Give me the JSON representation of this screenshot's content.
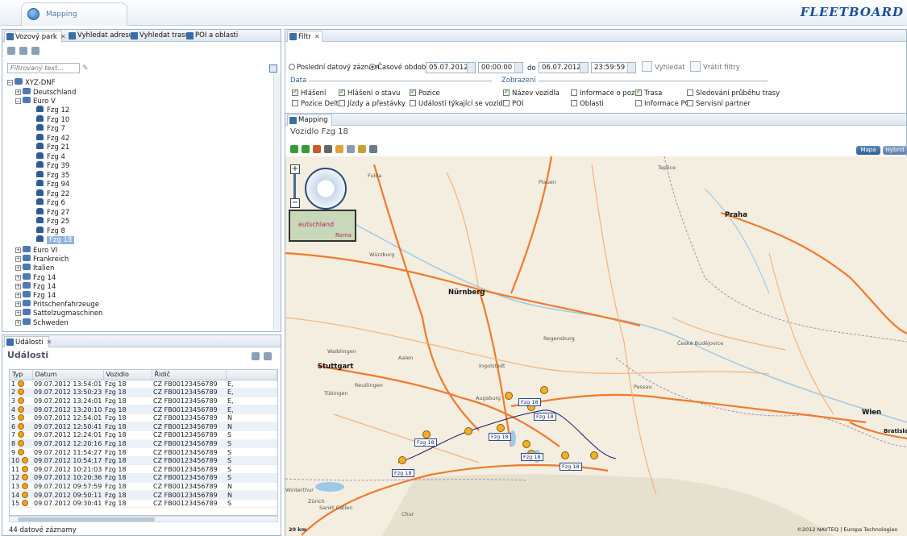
{
  "app": {
    "tab_label": "Mapping",
    "logo": "FLEETBOARD"
  },
  "left_top": {
    "tabs": [
      "Vozový park",
      "Vyhledat adresu",
      "Vyhledat trasu",
      "POI a oblasti"
    ],
    "filter_placeholder": "Filtrovaný text...",
    "tree": {
      "root": "XYZ-DNF",
      "groups": [
        "Deutschland",
        "Euro V"
      ],
      "vehicles": [
        "Fzg 12",
        "Fzg 10",
        "Fzg 7",
        "Fzg 42",
        "Fzg 21",
        "Fzg 4",
        "Fzg 39",
        "Fzg 35",
        "Fzg 94",
        "Fzg 22",
        "Fzg 6",
        "Fzg 27",
        "Fzg 25",
        "Fzg 8",
        "Fzg 18"
      ],
      "selected": "Fzg 18",
      "more_groups": [
        "Euro VI",
        "Frankreich",
        "Italien",
        "Fzg 14",
        "Fzg 14",
        "Fzg 14",
        "Pritschenfahrzeuge",
        "Sattelzugmaschinen",
        "Schweden"
      ]
    }
  },
  "events": {
    "tab": "Události",
    "heading": "Události",
    "columns": [
      "Typ",
      "Datum",
      "Vozidlo",
      "Řidič"
    ],
    "rows": [
      {
        "n": "1",
        "date": "09.07.2012 13:54:01",
        "vehicle": "Fzg 18",
        "driver": "CZ FB00123456789",
        "x": "E,"
      },
      {
        "n": "2",
        "date": "09.07.2012 13:50:23",
        "vehicle": "Fzg 18",
        "driver": "CZ FB00123456789",
        "x": "E,"
      },
      {
        "n": "3",
        "date": "09.07.2012 13:24:01",
        "vehicle": "Fzg 18",
        "driver": "CZ FB00123456789",
        "x": "E,"
      },
      {
        "n": "4",
        "date": "09.07.2012 13:20:10",
        "vehicle": "Fzg 18",
        "driver": "CZ FB00123456789",
        "x": "E,"
      },
      {
        "n": "5",
        "date": "09.07.2012 12:54:01",
        "vehicle": "Fzg 18",
        "driver": "CZ FB00123456789",
        "x": "N"
      },
      {
        "n": "6",
        "date": "09.07.2012 12:50:41",
        "vehicle": "Fzg 18",
        "driver": "CZ FB00123456789",
        "x": "N"
      },
      {
        "n": "7",
        "date": "09.07.2012 12:24:01",
        "vehicle": "Fzg 18",
        "driver": "CZ FB00123456789",
        "x": "S"
      },
      {
        "n": "8",
        "date": "09.07.2012 12:20:16",
        "vehicle": "Fzg 18",
        "driver": "CZ FB00123456789",
        "x": "S"
      },
      {
        "n": "9",
        "date": "09.07.2012 11:54:27",
        "vehicle": "Fzg 18",
        "driver": "CZ FB00123456789",
        "x": "S"
      },
      {
        "n": "10",
        "date": "09.07.2012 10:54:17",
        "vehicle": "Fzg 18",
        "driver": "CZ FB00123456789",
        "x": "S"
      },
      {
        "n": "11",
        "date": "09.07.2012 10:21:03",
        "vehicle": "Fzg 18",
        "driver": "CZ FB00123456789",
        "x": "S"
      },
      {
        "n": "12",
        "date": "09.07.2012 10:20:36",
        "vehicle": "Fzg 18",
        "driver": "CZ FB00123456789",
        "x": "S"
      },
      {
        "n": "13",
        "date": "09.07.2012 09:57:59",
        "vehicle": "Fzg 18",
        "driver": "CZ FB00123456789",
        "x": "N"
      },
      {
        "n": "14",
        "date": "09.07.2012 09:50:11",
        "vehicle": "Fzg 18",
        "driver": "CZ FB00123456789",
        "x": "N"
      },
      {
        "n": "15",
        "date": "09.07.2012 09:30:41",
        "vehicle": "Fzg 18",
        "driver": "CZ FB00123456789",
        "x": "S"
      }
    ],
    "count": "44 datové záznamy"
  },
  "filter": {
    "tab": "Filtr",
    "radio_last": "Poslední datový záznam",
    "radio_period": "Časové období",
    "date_from": "05.07.2012",
    "time_from": "00:00:00",
    "to_label": "do",
    "date_to": "06.07.2012",
    "time_to": "23:59:59",
    "search": "Vyhledat",
    "reset": "Vrátit filtry",
    "data_group": "Data",
    "data_items": [
      {
        "label": "Hlášení",
        "checked": true
      },
      {
        "label": "Hlášení o stavu",
        "checked": true
      },
      {
        "label": "Pozice",
        "checked": true
      },
      {
        "label": "Pozice Delta",
        "checked": false
      },
      {
        "label": "Jízdy a přestávky",
        "checked": false
      },
      {
        "label": "Události týkající se vozidla",
        "checked": false
      }
    ],
    "display_group": "Zobrazení",
    "display_items": [
      {
        "label": "Název vozidla",
        "checked": true
      },
      {
        "label": "Informace o pozici",
        "checked": false
      },
      {
        "label": "Trasa",
        "checked": true
      },
      {
        "label": "Sledování průběhu trasy",
        "checked": false
      },
      {
        "label": "POI",
        "checked": false
      },
      {
        "label": "Oblasti",
        "checked": false
      },
      {
        "label": "Informace POI",
        "checked": false
      },
      {
        "label": "Servisní partner",
        "checked": false
      }
    ]
  },
  "mapping": {
    "tab": "Mapping",
    "title": "Vozidlo Fzg 18",
    "btn_map": "Mapa",
    "btn_hybrid": "Hybrid",
    "cities": [
      "Praha",
      "Nürnberg",
      "Stuttgart",
      "Wien",
      "Bratislava"
    ],
    "towns": [
      "Würzburg",
      "Fulda",
      "Plauen",
      "Teplice",
      "Ingolstadt",
      "Regensburg",
      "Augsburg",
      "Reutlingen",
      "Tübingen",
      "Waiblingen",
      "Aalen",
      "České Budějovice",
      "Passau",
      "Winterthur",
      "Zürich",
      "Sankt Gallen",
      "Chur"
    ],
    "minimap_labels": [
      "eutschland",
      "Roma"
    ],
    "vehicle_label": "Fzg 18",
    "copyright": "©2012 NAVTEQ | Europa Technologies",
    "scale": "20 km"
  }
}
